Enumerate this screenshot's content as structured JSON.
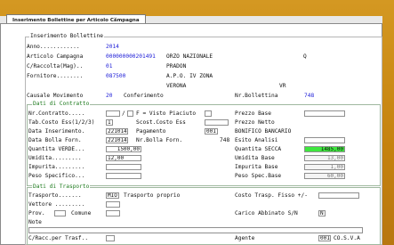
{
  "window": {
    "tab_title": "Inserimento Bollettine per Articolo Campagna",
    "tab_close": "x"
  },
  "section_header": "Inserimento Bollettine",
  "header": {
    "anno_label": "Anno............",
    "anno_value": "2014",
    "articolo_label": "Articolo Campagna",
    "articolo_code": "000000000201491",
    "articolo_desc": "ORZO NAZIONALE",
    "articolo_q": "Q",
    "raccolta_label": "C/Raccolta(Mag)..",
    "raccolta_code": "01",
    "raccolta_desc": "PRADON",
    "fornitore_label": "Fornitore........",
    "fornitore_code": "087500",
    "fornitore_desc1": "A.P.O. IV ZONA",
    "fornitore_desc2": "VERONA",
    "fornitore_prov": "VR",
    "causale_label": "Causale Movimento",
    "causale_code": "20",
    "causale_desc": "Conferimento",
    "nr_boll_label": "Nr.Bollettina",
    "nr_boll_value": "748"
  },
  "contratto": {
    "title": "Dati di Contratto",
    "nr_contratto_label": "Nr.Contratto.....",
    "slash": "/",
    "visto_label": "F = Visto Piaciuto",
    "prezzo_base_label": "Prezzo Base",
    "tab_costo_label": "Tab.Costo Ess(1/2/3)",
    "tab_costo_value": "1",
    "scost_label": "Scost.Costo Ess",
    "prezzo_netto_label": "Prezzo Netto",
    "data_ins_label": "Data Inserimento.",
    "data_ins_value": "221014",
    "pagamento_label": "Pagamento",
    "pagamento_code": "001",
    "pagamento_desc": "BONIFICO BANCARIO",
    "data_bolla_label": "Data Bolla Forn.",
    "data_bolla_value": "221014",
    "nr_bolla_label": "Nr.Bolla Forn.",
    "nr_bolla_value": "748",
    "esito_label": "Esito Analisi",
    "quantita_verde_label": "Quantita VERDE...",
    "quantita_verde_value": "1500,00",
    "quantita_secca_label": "Quantita SECCA",
    "quantita_secca_value": "1485,00",
    "umidita_label": "Umidita.........",
    "umidita_value": "12,00",
    "umidita_base_label": "Umidita Base",
    "umidita_base_value": "13,00",
    "impurita_label": "Impurita.........",
    "impurita_base_label": "Impurita Base",
    "impurita_base_value": "1,00",
    "peso_spec_label": "Peso Specifico...",
    "peso_spec_base_label": "Peso Spec.Base",
    "peso_spec_base_value": "60,00"
  },
  "trasporto": {
    "title": "Dati di Trasporto",
    "trasporto_label": "Trasporto.......",
    "trasporto_code": "MIO",
    "trasporto_desc": "Trasporto proprio",
    "costo_fisso_label": "Costo Trasp. Fisso +/-",
    "vettore_label": "Vettore .........",
    "prov_label": "Prov.",
    "comune_label": "Comune",
    "carico_label": "Carico Abbinato S/N",
    "carico_value": "N",
    "note_label": "Note",
    "c_racc_label": "C/Racc.per Trasf..",
    "agente_label": "Agente",
    "agente_code": "001",
    "agente_desc": "CO.S.V.A"
  }
}
